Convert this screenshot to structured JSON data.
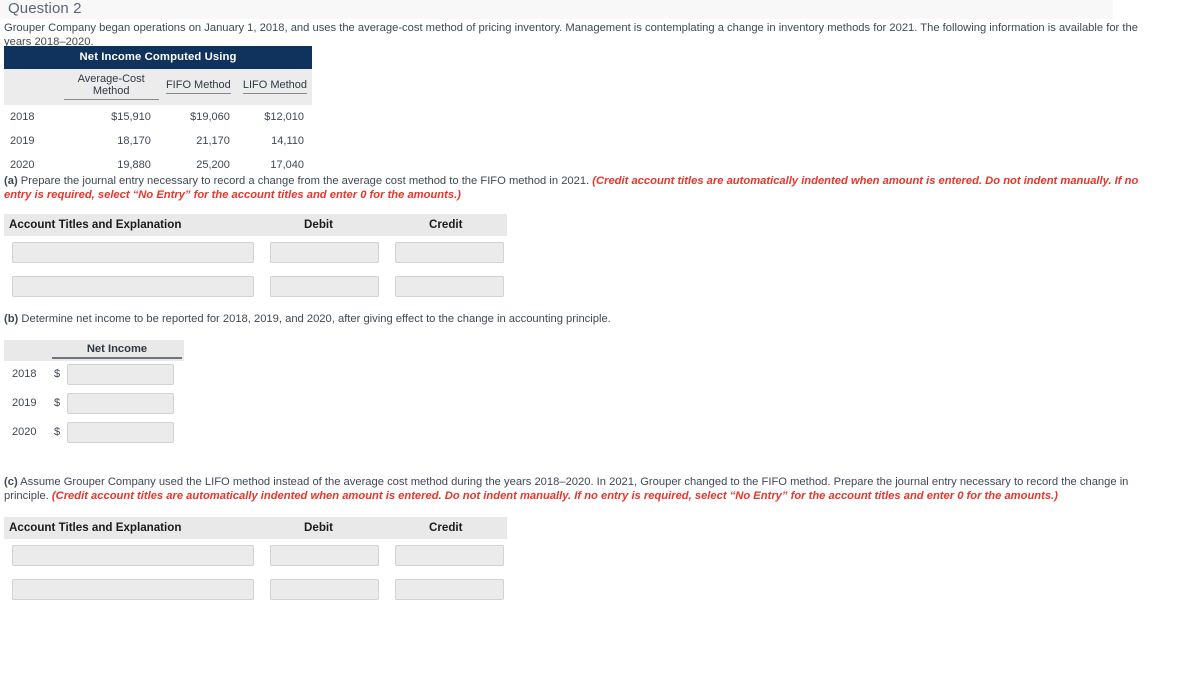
{
  "header": {
    "question_title": "Question 2"
  },
  "intro": {
    "text": "Grouper Company began operations on January 1, 2018, and uses the average-cost method of pricing inventory. Management is contemplating a change in inventory methods for 2021. The following information is available for the years 2018–2020."
  },
  "income_table": {
    "title": "Net Income Computed Using",
    "columns": [
      "Average-Cost Method",
      "FIFO Method",
      "LIFO Method"
    ],
    "rows": [
      {
        "year": "2018",
        "average_cost": "$15,910",
        "fifo": "$19,060",
        "lifo": "$12,010"
      },
      {
        "year": "2019",
        "average_cost": "18,170",
        "fifo": "21,170",
        "lifo": "14,110"
      },
      {
        "year": "2020",
        "average_cost": "19,880",
        "fifo": "25,200",
        "lifo": "17,040"
      }
    ]
  },
  "part_a": {
    "marker": "(a)",
    "prompt": " Prepare the journal entry necessary to record a change from the average cost method to the FIFO method in 2021. ",
    "note": "(Credit account titles are automatically indented when amount is entered. Do not indent manually. If no entry is required, select “No Entry” for the account titles and enter 0 for the amounts.)",
    "table": {
      "headers": {
        "account": "Account Titles and Explanation",
        "debit": "Debit",
        "credit": "Credit"
      },
      "rows": [
        {
          "account": "",
          "debit": "",
          "credit": ""
        },
        {
          "account": "",
          "debit": "",
          "credit": ""
        }
      ]
    }
  },
  "part_b": {
    "marker": "(b)",
    "prompt": " Determine net income to be reported for 2018, 2019, and 2020, after giving effect to the change in accounting principle.",
    "table": {
      "header": "Net Income",
      "currency_symbol": "$",
      "rows": [
        {
          "year": "2018",
          "value": ""
        },
        {
          "year": "2019",
          "value": ""
        },
        {
          "year": "2020",
          "value": ""
        }
      ]
    }
  },
  "part_c": {
    "marker": "(c)",
    "prompt": " Assume Grouper Company used the LIFO method instead of the average cost method during the years 2018–2020. In 2021, Grouper changed to the FIFO method. Prepare the journal entry necessary to record the change in principle. ",
    "note": "(Credit account titles are automatically indented when amount is entered. Do not indent manually. If no entry is required, select “No Entry” for the account titles and enter 0 for the amounts.)",
    "table": {
      "headers": {
        "account": "Account Titles and Explanation",
        "debit": "Debit",
        "credit": "Credit"
      },
      "rows": [
        {
          "account": "",
          "debit": "",
          "credit": ""
        },
        {
          "account": "",
          "debit": "",
          "credit": ""
        }
      ]
    }
  },
  "colors": {
    "navy_header": "#10335e",
    "note_red": "#e8352b",
    "input_fill": "#ebebeb",
    "band_gray": "#e9e9e9"
  }
}
